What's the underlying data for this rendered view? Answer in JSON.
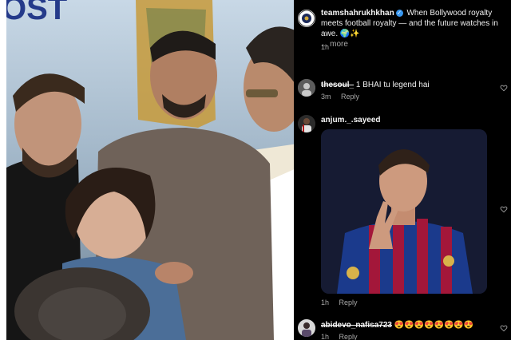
{
  "post": {
    "author": "teamshahrukhkhan",
    "caption": "When Bollywood royalty meets football royalty — and the future watches in awe. 🌍✨",
    "more_label": "... more",
    "time": "1h",
    "banner_text": "OST"
  },
  "comments": [
    {
      "user": "thesoul_",
      "text": "1 BHAI tu legend hai",
      "time": "3m",
      "reply_label": "Reply"
    },
    {
      "user": "anjum._.sayeed",
      "time": "1h",
      "reply_label": "Reply"
    },
    {
      "user": "abidevo_nafisa723",
      "text": "😍😍😍😍😍😍😍😍",
      "time": "1h",
      "reply_label": "Reply"
    }
  ],
  "colors": {
    "panel_bg": "#000000",
    "accent_verified": "#3897f0",
    "jersey_blue": "#1b3a8c",
    "jersey_red": "#a3173a"
  },
  "icons": [
    "verified-badge-icon",
    "heart-icon"
  ]
}
